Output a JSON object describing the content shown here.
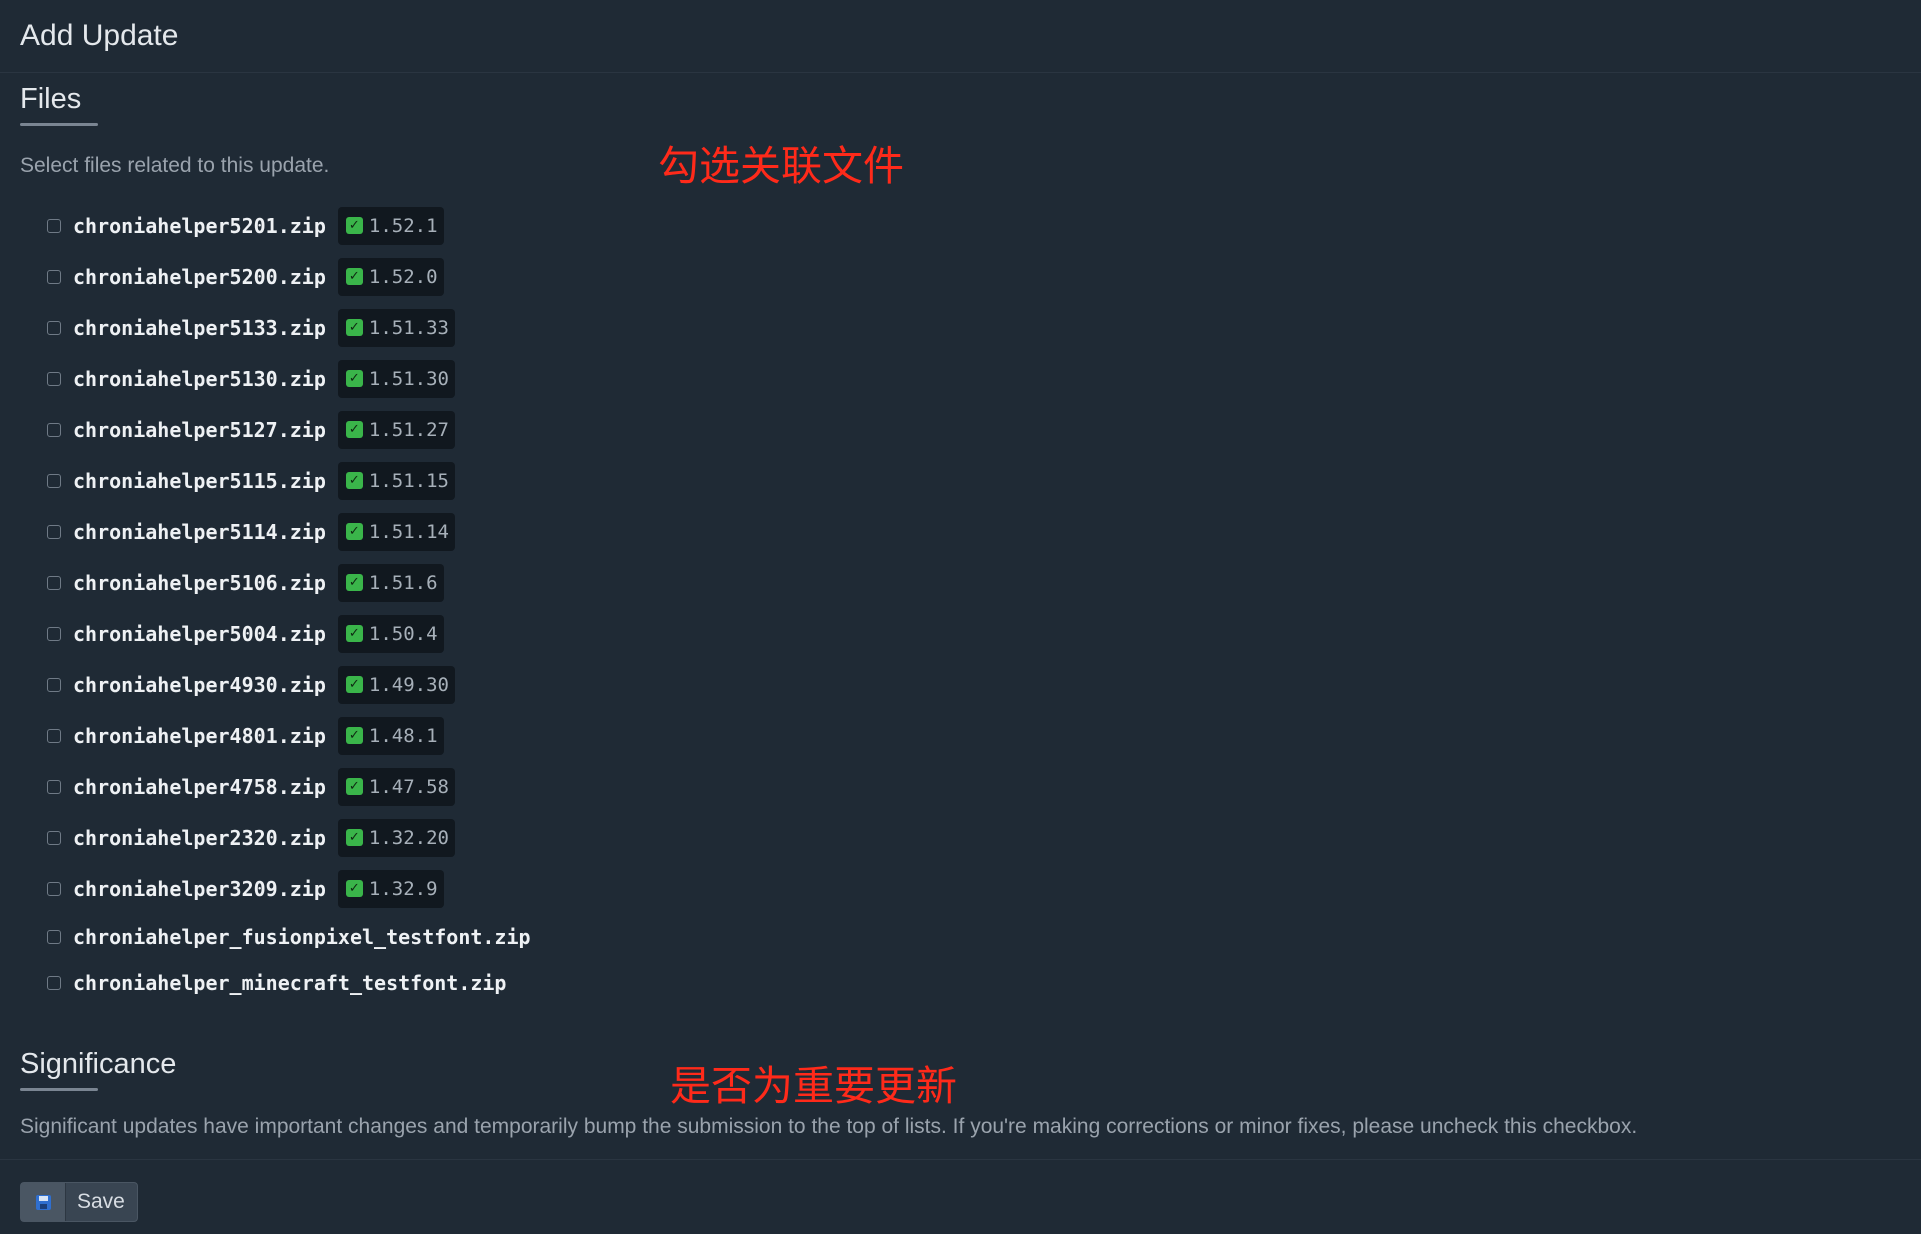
{
  "header": {
    "title": "Add Update"
  },
  "files": {
    "title": "Files",
    "description": "Select files related to this update.",
    "items": [
      {
        "name": "chroniahelper5201.zip",
        "version": "1.52.1"
      },
      {
        "name": "chroniahelper5200.zip",
        "version": "1.52.0"
      },
      {
        "name": "chroniahelper5133.zip",
        "version": "1.51.33"
      },
      {
        "name": "chroniahelper5130.zip",
        "version": "1.51.30"
      },
      {
        "name": "chroniahelper5127.zip",
        "version": "1.51.27"
      },
      {
        "name": "chroniahelper5115.zip",
        "version": "1.51.15"
      },
      {
        "name": "chroniahelper5114.zip",
        "version": "1.51.14"
      },
      {
        "name": "chroniahelper5106.zip",
        "version": "1.51.6"
      },
      {
        "name": "chroniahelper5004.zip",
        "version": "1.50.4"
      },
      {
        "name": "chroniahelper4930.zip",
        "version": "1.49.30"
      },
      {
        "name": "chroniahelper4801.zip",
        "version": "1.48.1"
      },
      {
        "name": "chroniahelper4758.zip",
        "version": "1.47.58"
      },
      {
        "name": "chroniahelper2320.zip",
        "version": "1.32.20"
      },
      {
        "name": "chroniahelper3209.zip",
        "version": "1.32.9"
      },
      {
        "name": "chroniahelper_fusionpixel_testfont.zip",
        "version": null
      },
      {
        "name": "chroniahelper_minecraft_testfont.zip",
        "version": null
      }
    ],
    "badge_icon": "verified-check-icon",
    "badge_icon_glyph": "✓",
    "badge_color": "#3ab54a"
  },
  "significance": {
    "title": "Significance",
    "description": "Significant updates have important changes and temporarily bump the submission to the top of lists. If you're making corrections or minor fixes, please uncheck this checkbox."
  },
  "actions": {
    "save_label": "Save",
    "save_icon": "floppy-disk-icon"
  },
  "annotations": {
    "files_note": "勾选关联文件",
    "significance_note": "是否为重要更新",
    "color": "#ff2a1a"
  }
}
